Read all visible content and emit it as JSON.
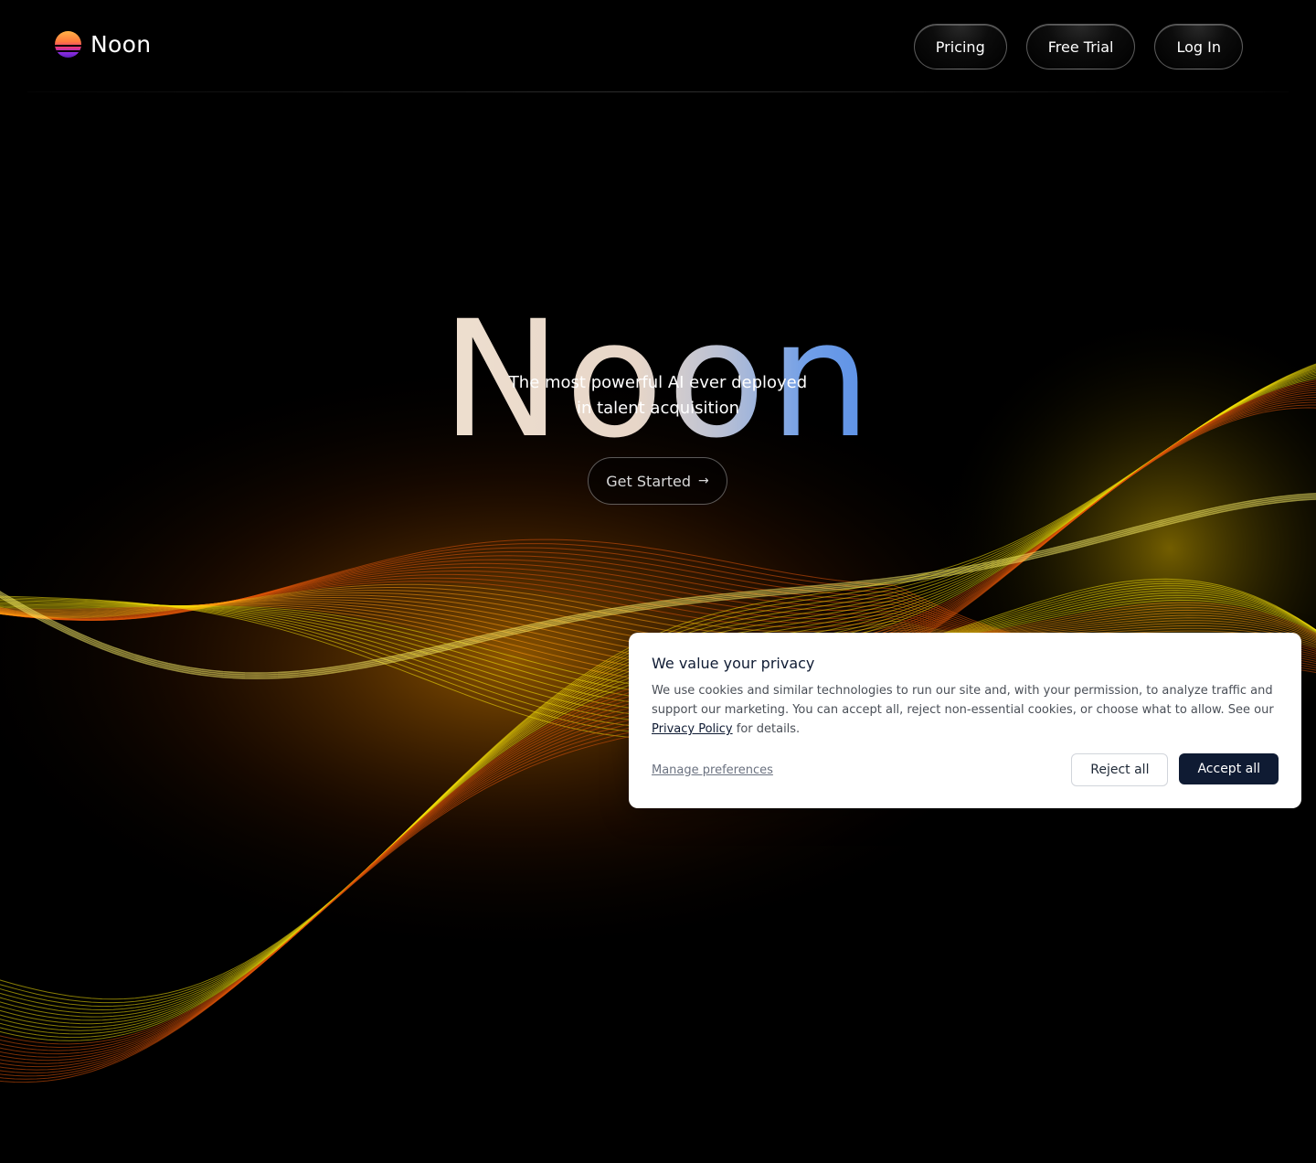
{
  "header": {
    "brand_name": "Noon",
    "nav": {
      "pricing_label": "Pricing",
      "free_trial_label": "Free Trial",
      "login_label": "Log In"
    }
  },
  "hero": {
    "title": "Noon",
    "subtitle_line1": "The most powerful AI ever deployed",
    "subtitle_line2": "in talent acquisition",
    "cta_label": "Get Started",
    "cta_icon": "arrow-right-icon"
  },
  "cookie_banner": {
    "title": "We value your privacy",
    "text_before_link": "We use cookies and similar technologies to run our site and, with your permission, to analyze traffic and support our marketing. You can accept all, reject non-essential cookies, or choose what to allow. See our ",
    "link_label": "Privacy Policy",
    "text_after_link": " for details.",
    "manage_label": "Manage preferences",
    "reject_label": "Reject all",
    "accept_label": "Accept all"
  },
  "colors": {
    "background": "#000000",
    "title_gradient_start": "#eedfcf",
    "title_gradient_end": "#5b90e6",
    "wave_yellow": "#f5e10a",
    "wave_orange": "#e0560a",
    "accept_button": "#0f1b33"
  }
}
